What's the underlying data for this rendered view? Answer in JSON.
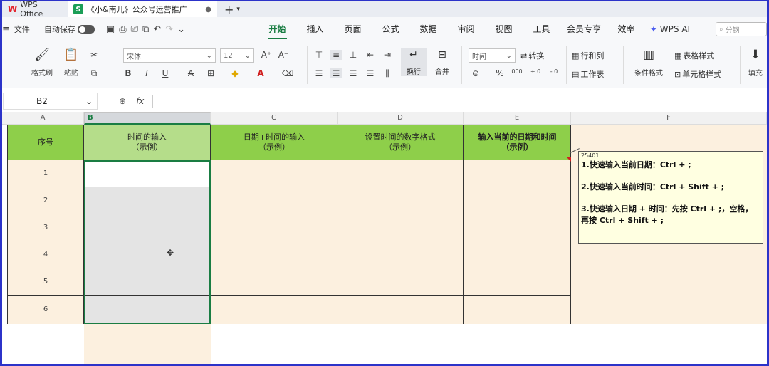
{
  "titlebar": {
    "app_name": "WPS Office",
    "doc_badge": "S",
    "doc_title": "《小&南儿》公众号运营推广",
    "plus": "+",
    "chevron": "⌄"
  },
  "menubar": {
    "file_label": "文件",
    "autosave_label": "自动保存",
    "tabs": [
      "开始",
      "插入",
      "页面",
      "公式",
      "数据",
      "审阅",
      "视图",
      "工具",
      "会员专享",
      "效率",
      "WPS AI"
    ],
    "active_tab": "开始",
    "search_placeholder": "分钢"
  },
  "ribbon": {
    "format_painter": "格式刷",
    "paste": "粘贴",
    "font_name": "宋体",
    "font_size": "12",
    "number_format": "时间",
    "wrap": "换行",
    "merge": "合并",
    "convert": "转换",
    "rows_cols": "行和列",
    "worksheet": "工作表",
    "cond_format": "条件格式",
    "table_style": "表格样式",
    "cell_style": "单元格样式",
    "fill": "填充",
    "font_size_up": "A⁺",
    "font_size_down": "A⁻",
    "percent": "%",
    "thousands": "000",
    "dec_inc": "+.0",
    "dec_dec": "-.0"
  },
  "formula_bar": {
    "cell_ref": "B2",
    "fx": "fx",
    "formula": ""
  },
  "columns": [
    "A",
    "B",
    "C",
    "D",
    "E",
    "F"
  ],
  "selected_column": "B",
  "table": {
    "headers": {
      "a": "序号",
      "b": [
        "时间的输入",
        "（示例）"
      ],
      "c": [
        "日期+时间的输入",
        "（示例）"
      ],
      "d": [
        "设置时间的数字格式",
        "（示例）"
      ],
      "e": [
        "输入当前的日期和时间",
        "（示例）"
      ]
    },
    "rows": [
      "1",
      "2",
      "3",
      "4",
      "5",
      "6"
    ]
  },
  "comment": {
    "author": "25401:",
    "lines": [
      "1.快速输入当前日期：Ctrl + ;",
      "2.快速输入当前时间：Ctrl + Shift + ;",
      "3.快速输入日期 + 时间：先按 Ctrl + ;，空格，再按 Ctrl + Shift + ;"
    ]
  },
  "colors": {
    "header_green": "#8ecf4a",
    "body_beige": "#fcf0df",
    "selection_green": "#1a7d43",
    "frame_blue": "#2c33c9"
  }
}
